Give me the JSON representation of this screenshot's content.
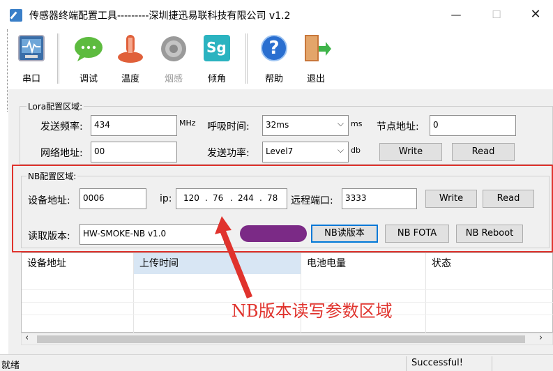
{
  "window": {
    "title": "传感器终端配置工具---------深圳捷迅易联科技有限公司 v1.2",
    "min_glyph": "—",
    "max_glyph": "☐",
    "close_glyph": "✕"
  },
  "toolbar": {
    "items": [
      {
        "label": "串口",
        "icon": "serial-port-icon"
      },
      {
        "label": "调试",
        "icon": "chat-bubble-icon"
      },
      {
        "label": "温度",
        "icon": "thermometer-icon"
      },
      {
        "label": "烟感",
        "icon": "smoke-sensor-icon",
        "disabled": true
      },
      {
        "label": "倾角",
        "icon": "tilt-sg-icon"
      },
      {
        "label": "帮助",
        "icon": "help-icon"
      },
      {
        "label": "退出",
        "icon": "exit-door-icon"
      }
    ],
    "sg_text": "Sg",
    "help_glyph": "?"
  },
  "lora": {
    "group_title": "Lora配置区域:",
    "freq_label": "发送频率:",
    "freq_value": "434",
    "freq_unit": "MHz",
    "breath_label": "呼吸时间:",
    "breath_value": "32ms",
    "breath_unit": "ms",
    "node_label": "节点地址:",
    "node_value": "0",
    "net_label": "网络地址:",
    "net_value": "00",
    "power_label": "发送功率:",
    "power_value": "Level7",
    "power_unit": "db",
    "write_label": "Write",
    "read_label": "Read"
  },
  "nb": {
    "group_title": "NB配置区域:",
    "dev_label": "设备地址:",
    "dev_value": "0006",
    "ip_label": "ip:",
    "ip_octets": [
      "120",
      "76",
      "244",
      "78"
    ],
    "port_label": "远程端口:",
    "port_value": "3333",
    "write_label": "Write",
    "read_label": "Read",
    "version_label": "读取版本:",
    "version_value": "HW-SMOKE-NB v1.0",
    "read_version_label": "NB读版本",
    "fota_label": "NB FOTA",
    "reboot_label": "NB Reboot"
  },
  "list": {
    "columns": [
      "设备地址",
      "上传时间",
      "电池电量",
      "状态"
    ]
  },
  "scroll": {
    "left": "‹",
    "right": "›"
  },
  "status": {
    "left": "就绪",
    "right": "Successful!"
  },
  "annotation": {
    "text": "NB版本读写参数区域",
    "color": "#e0332d"
  },
  "colors": {
    "highlight": "#e0332d",
    "panel": "#f0f0f0",
    "selected_header": "#d8e6f4",
    "focus_border": "#0078d7"
  }
}
